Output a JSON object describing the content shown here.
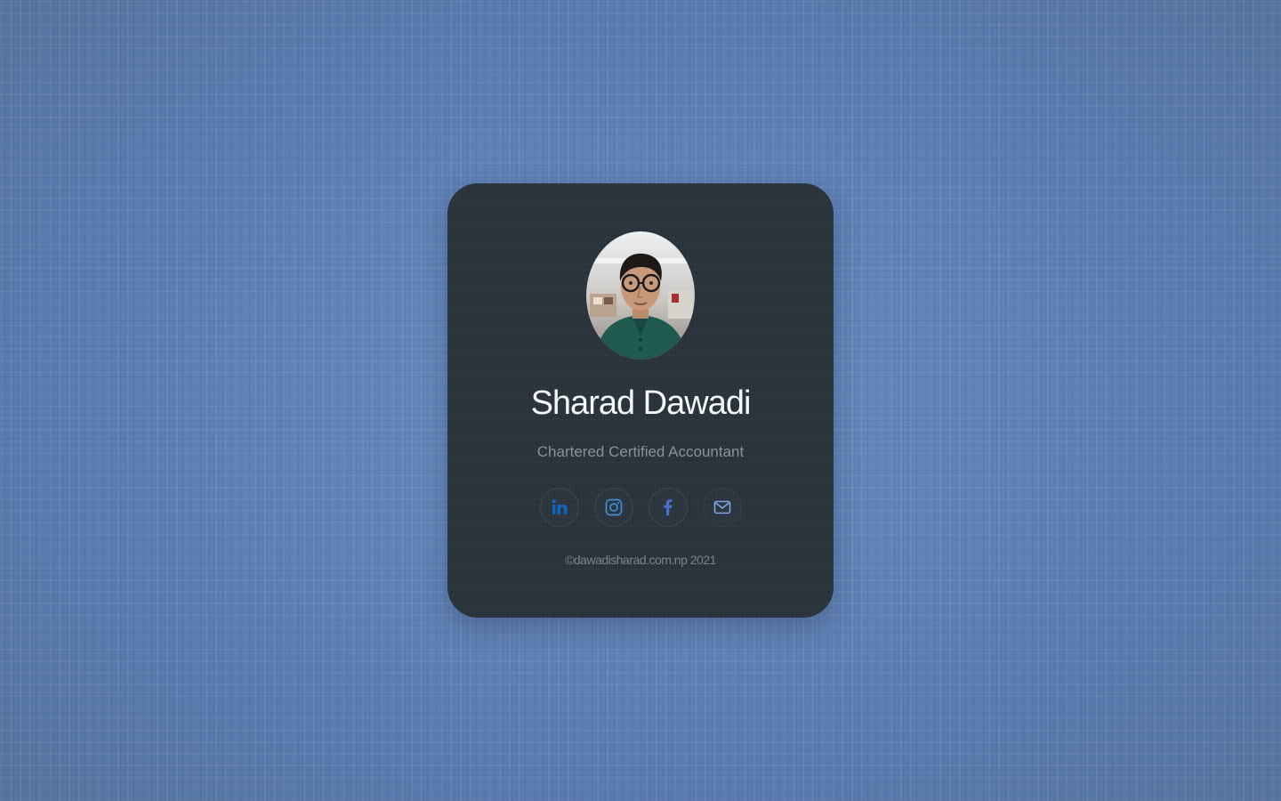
{
  "profile": {
    "name": "Sharad Dawadi",
    "title": "Chartered Certified Accountant",
    "avatar_icon": "profile-photo"
  },
  "socials": [
    {
      "icon": "linkedin-icon",
      "color": "#0a66c2"
    },
    {
      "icon": "instagram-icon",
      "color": "#3f8fd8"
    },
    {
      "icon": "facebook-icon",
      "color": "#4a6fd6"
    },
    {
      "icon": "mail-icon",
      "color": "#7ea3e6"
    }
  ],
  "footer": {
    "copyright": "©dawadisharad.com.np  2021"
  },
  "colors": {
    "background": "#5e7fb4",
    "card": "#2b353e",
    "name_text": "#f4f6f8",
    "muted_text": "#8a9299"
  }
}
